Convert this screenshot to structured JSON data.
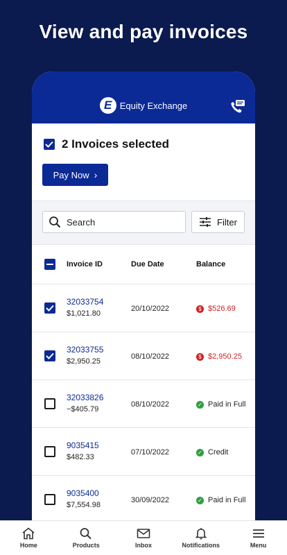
{
  "promo": {
    "title": "View and pay invoices"
  },
  "header": {
    "brand": "Equity Exchange",
    "logo_letter": "E"
  },
  "selection": {
    "text": "2 Invoices selected",
    "pay_label": "Pay Now"
  },
  "search": {
    "placeholder": "Search",
    "filter_label": "Filter"
  },
  "table": {
    "headers": {
      "id": "Invoice ID",
      "due": "Due Date",
      "balance": "Balance"
    },
    "rows": [
      {
        "id": "32033754",
        "amount": "$1,021.80",
        "due": "20/10/2022",
        "balance": "$526.69",
        "status": "due",
        "checked": true
      },
      {
        "id": "32033755",
        "amount": "$2,950.25",
        "due": "08/10/2022",
        "balance": "$2,950.25",
        "status": "due",
        "checked": true
      },
      {
        "id": "32033826",
        "amount": "−$405.79",
        "due": "08/10/2022",
        "balance": "Paid in Full",
        "status": "paid",
        "checked": false
      },
      {
        "id": "9035415",
        "amount": "$482.33",
        "due": "07/10/2022",
        "balance": "Credit",
        "status": "paid",
        "checked": false
      },
      {
        "id": "9035400",
        "amount": "$7,554.98",
        "due": "30/09/2022",
        "balance": "Paid in Full",
        "status": "paid",
        "checked": false
      }
    ]
  },
  "tabs": [
    {
      "label": "Home",
      "icon": "home-icon"
    },
    {
      "label": "Products",
      "icon": "search-icon"
    },
    {
      "label": "Inbox",
      "icon": "mail-icon"
    },
    {
      "label": "Notifications",
      "icon": "bell-icon"
    },
    {
      "label": "Menu",
      "icon": "menu-icon"
    }
  ],
  "colors": {
    "brand": "#0b2a96",
    "background": "#0b1a4f",
    "due": "#d11f1f",
    "paid": "#2f9e44"
  }
}
